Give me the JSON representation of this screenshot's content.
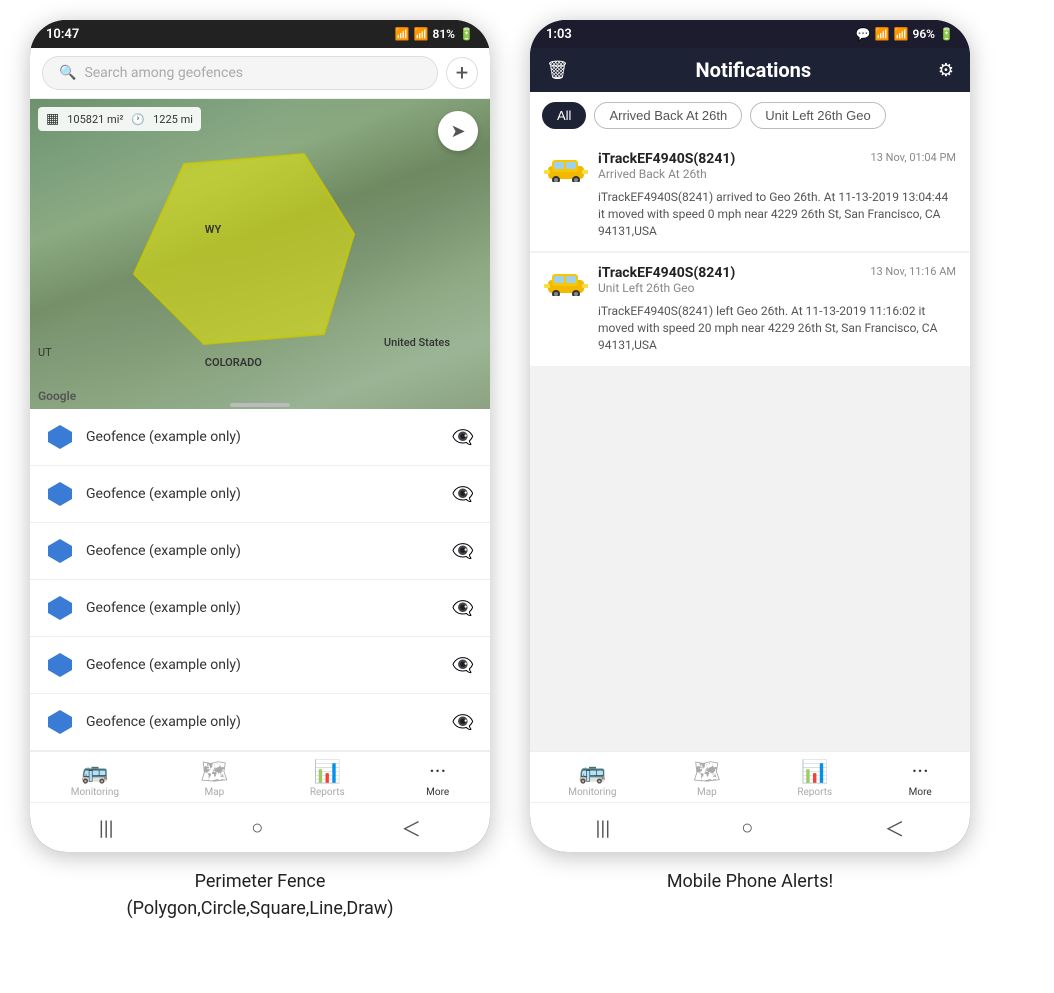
{
  "left_phone": {
    "status_bar": {
      "time": "10:47",
      "signal": "WiFi",
      "battery": "81%"
    },
    "search": {
      "placeholder": "Search among geofences"
    },
    "map": {
      "area": "105821 mi²",
      "distance": "1225 mi",
      "label_wy": "WY",
      "label_us": "United States",
      "label_co": "COLORADO",
      "label_ut": "UT",
      "google": "Google"
    },
    "geofence_items": [
      {
        "name": "Geofence (example only)"
      },
      {
        "name": "Geofence (example only)"
      },
      {
        "name": "Geofence (example only)"
      },
      {
        "name": "Geofence (example only)"
      },
      {
        "name": "Geofence (example only)"
      },
      {
        "name": "Geofence (example only)"
      }
    ],
    "bottom_nav": [
      {
        "label": "Monitoring",
        "icon": "🚌"
      },
      {
        "label": "Map",
        "icon": "🗺"
      },
      {
        "label": "Reports",
        "icon": "📊"
      },
      {
        "label": "More",
        "icon": "···"
      }
    ]
  },
  "right_phone": {
    "status_bar": {
      "time": "1:03",
      "battery": "96%"
    },
    "header": {
      "title": "Notifications",
      "delete_icon": "🗑",
      "settings_icon": "⚙"
    },
    "filters": [
      {
        "label": "All",
        "active": true
      },
      {
        "label": "Arrived Back At 26th",
        "active": false
      },
      {
        "label": "Unit Left 26th Geo",
        "active": false
      }
    ],
    "notifications": [
      {
        "device": "iTrackEF4940S(8241)",
        "event": "Arrived Back At 26th",
        "time": "13 Nov, 01:04 PM",
        "description": "iTrackEF4940S(8241) arrived to Geo 26th.    At 11-13-2019 13:04:44 it moved with speed 0 mph near 4229 26th St, San Francisco, CA 94131,USA"
      },
      {
        "device": "iTrackEF4940S(8241)",
        "event": "Unit Left 26th Geo",
        "time": "13 Nov, 11:16 AM",
        "description": "iTrackEF4940S(8241) left Geo 26th.    At 11-13-2019 11:16:02 it moved with speed 20 mph near 4229 26th St, San Francisco, CA 94131,USA"
      }
    ],
    "bottom_nav": [
      {
        "label": "Monitoring",
        "icon": "🚌"
      },
      {
        "label": "Map",
        "icon": "🗺"
      },
      {
        "label": "Reports",
        "icon": "📊"
      },
      {
        "label": "More",
        "icon": "···"
      }
    ]
  },
  "captions": {
    "left": "Perimeter Fence\n(Polygon,Circle,Square,Line,Draw)",
    "right": "Mobile Phone Alerts!"
  }
}
